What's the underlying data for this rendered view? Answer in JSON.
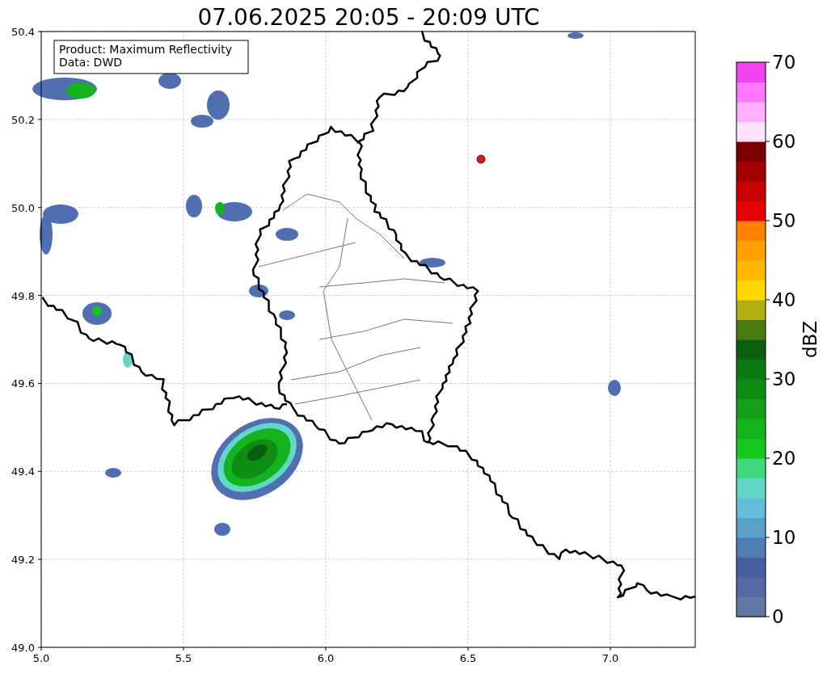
{
  "title": "07.06.2025 20:05 - 20:09 UTC",
  "info_box": [
    "Product: Maximum Reflectivity",
    "Data: DWD"
  ],
  "axes": {
    "xticks": [
      "5.0",
      "5.5",
      "6.0",
      "6.5",
      "7.0"
    ],
    "yticks": [
      "50.4",
      "50.2",
      "50.0",
      "49.8",
      "49.6",
      "49.4",
      "49.2",
      "49.0"
    ]
  },
  "marker": {
    "color": "#e8141c"
  },
  "colorbar": {
    "label": "dBZ",
    "ticks": [
      "70",
      "60",
      "50",
      "40",
      "30",
      "20",
      "10",
      "0"
    ],
    "bins": [
      {
        "color": "#6478a8"
      },
      {
        "color": "#556aa4"
      },
      {
        "color": "#4560a0"
      },
      {
        "color": "#4f7db4"
      },
      {
        "color": "#5b9ec8"
      },
      {
        "color": "#64bcd8"
      },
      {
        "color": "#62d6c8"
      },
      {
        "color": "#40d878"
      },
      {
        "color": "#14c81e"
      },
      {
        "color": "#14b41e"
      },
      {
        "color": "#12a01a"
      },
      {
        "color": "#0e8c14"
      },
      {
        "color": "#0c7812"
      },
      {
        "color": "#0a5e10"
      },
      {
        "color": "#4a7a10"
      },
      {
        "color": "#b0b010"
      },
      {
        "color": "#ffd700"
      },
      {
        "color": "#ffb800"
      },
      {
        "color": "#ffa000"
      },
      {
        "color": "#ff7f00"
      },
      {
        "color": "#e60000"
      },
      {
        "color": "#c80000"
      },
      {
        "color": "#a00000"
      },
      {
        "color": "#7a0000"
      },
      {
        "color": "#ffe0ff"
      },
      {
        "color": "#ffb0ff"
      },
      {
        "color": "#ff78ff"
      },
      {
        "color": "#f040f0"
      }
    ]
  }
}
